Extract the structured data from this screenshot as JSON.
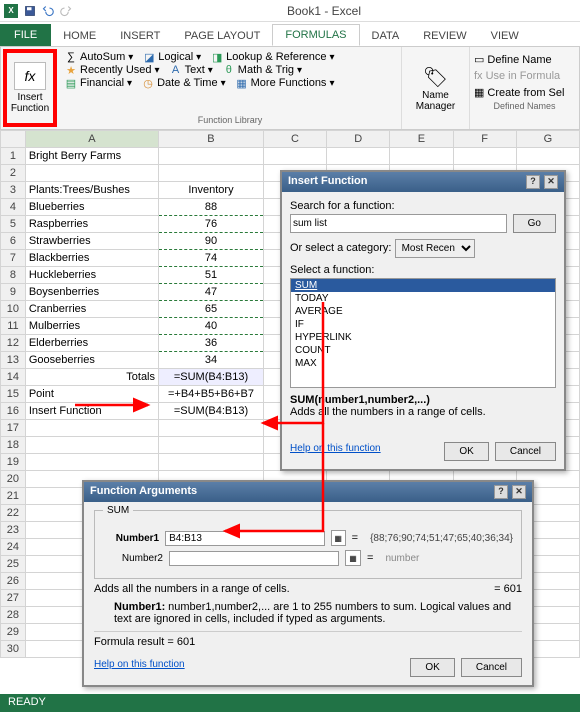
{
  "window_title": "Book1 - Excel",
  "tabs": {
    "file": "FILE",
    "home": "HOME",
    "insert": "INSERT",
    "page_layout": "PAGE LAYOUT",
    "formulas": "FORMULAS",
    "data": "DATA",
    "review": "REVIEW",
    "view": "VIEW"
  },
  "fx": {
    "symbol": "fx",
    "label": "Insert Function"
  },
  "lib": {
    "autosum": "AutoSum",
    "logical": "Logical",
    "lookup": "Lookup & Reference",
    "recent": "Recently Used",
    "text": "Text",
    "math": "Math & Trig",
    "financial": "Financial",
    "datetime": "Date & Time",
    "more": "More Functions",
    "group": "Function Library"
  },
  "name_mgr": {
    "label": "Name Manager"
  },
  "defnames": {
    "define": "Define Name",
    "use": "Use in Formula",
    "create": "Create from Sel",
    "group": "Defined Names"
  },
  "cols": [
    "A",
    "B",
    "C",
    "D",
    "E",
    "F",
    "G"
  ],
  "cells": {
    "A1": "Bright Berry Farms",
    "A3": "Plants:Trees/Bushes",
    "B3": "Inventory",
    "A4": "Blueberries",
    "B4": "88",
    "A5": "Raspberries",
    "B5": "76",
    "A6": "Strawberries",
    "B6": "90",
    "A7": "Blackberries",
    "B7": "74",
    "A8": "Huckleberries",
    "B8": "51",
    "A9": "Boysenberries",
    "B9": "47",
    "A10": "Cranberries",
    "B10": "65",
    "A11": "Mulberries",
    "B11": "40",
    "A12": "Elderberries",
    "B12": "36",
    "A13": "Gooseberries",
    "B13": "34",
    "A14": "Totals",
    "B14": "=SUM(B4:B13)",
    "A15": "Point",
    "B15": "=+B4+B5+B6+B7",
    "A16": "Insert Function",
    "B16": "=SUM(B4:B13)"
  },
  "insert_dlg": {
    "title": "Insert Function",
    "search_lbl": "Search for a function:",
    "search_val": "sum list",
    "go": "Go",
    "cat_lbl": "Or select a category:",
    "cat_val": "Most Recen",
    "sel_lbl": "Select a function:",
    "funcs": [
      "SUM",
      "TODAY",
      "AVERAGE",
      "IF",
      "HYPERLINK",
      "COUNT",
      "MAX"
    ],
    "syntax": "SUM(number1,number2,...)",
    "desc": "Adds all the numbers in a range of cells.",
    "help": "Help on this function",
    "ok": "OK",
    "cancel": "Cancel"
  },
  "fa_dlg": {
    "title": "Function Arguments",
    "legend": "SUM",
    "n1_lbl": "Number1",
    "n1_val": "B4:B13",
    "n1_res": "{88;76;90;74;51;47;65;40;36;34}",
    "n2_lbl": "Number2",
    "n2_res": "number",
    "desc": "Adds all the numbers in a range of cells.",
    "result_eq": "=",
    "result_val": "601",
    "arg_help": "Number1:  number1,number2,... are 1 to 255 numbers to sum. Logical values and text are ignored in cells, included if typed as arguments.",
    "formula_result": "Formula result =   601",
    "help": "Help on this function",
    "ok": "OK",
    "cancel": "Cancel"
  },
  "status": "READY"
}
